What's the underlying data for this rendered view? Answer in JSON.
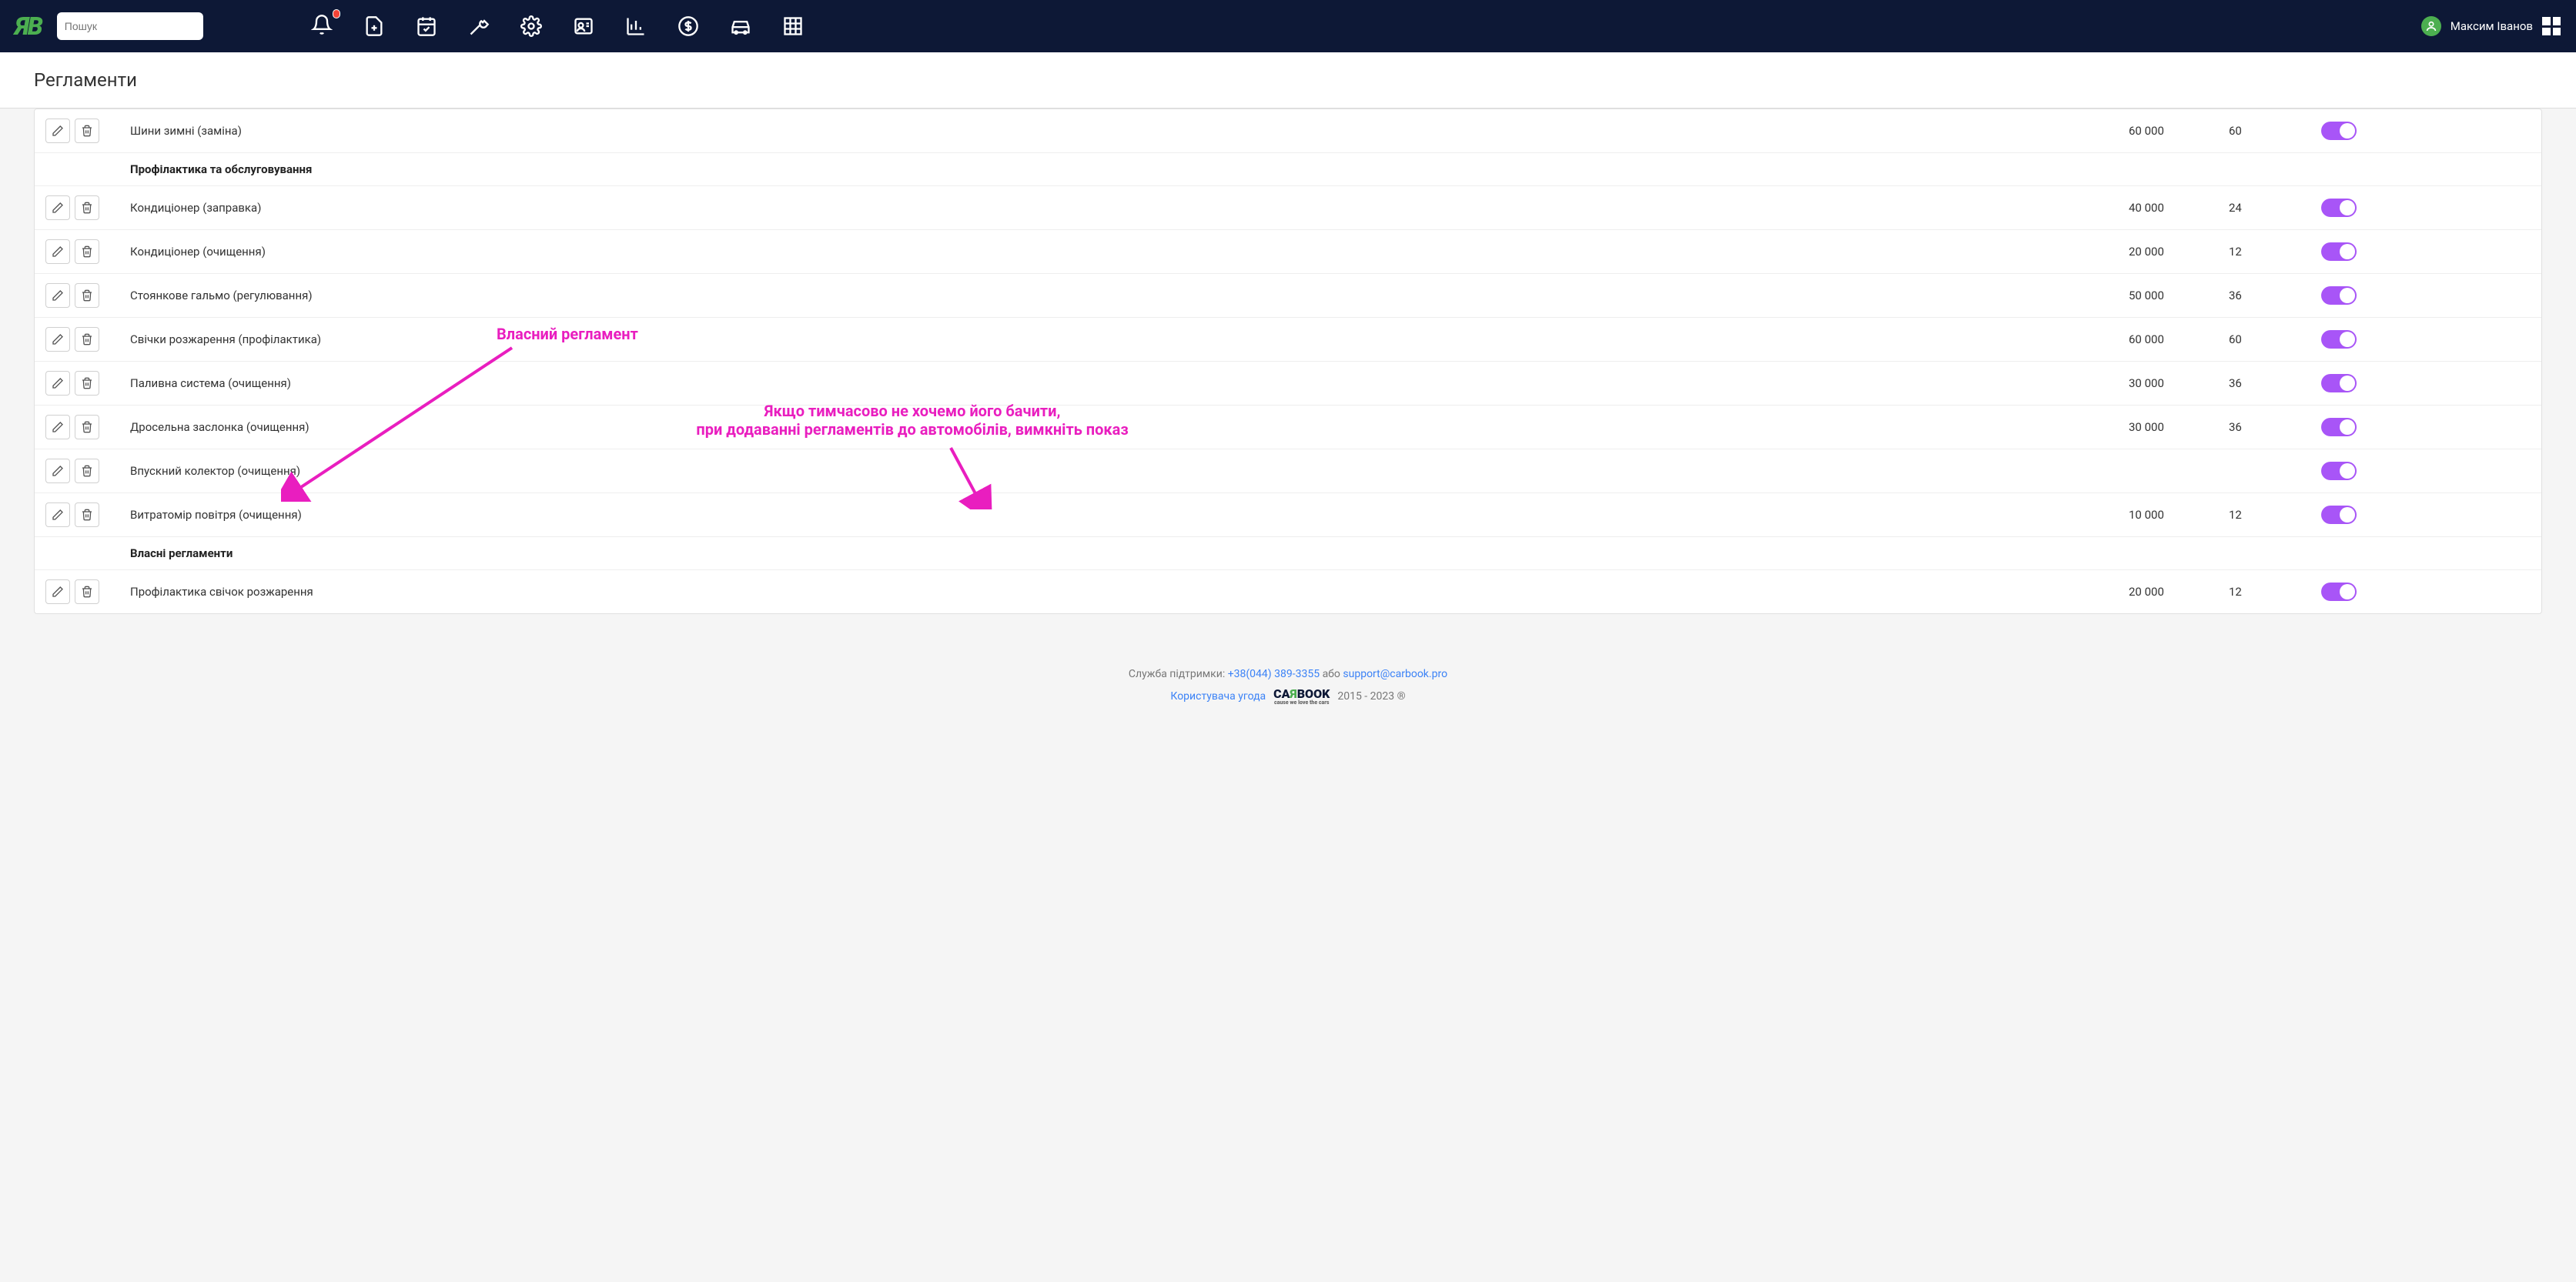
{
  "header": {
    "search_placeholder": "Пошук",
    "user_name": "Максим Іванов"
  },
  "page": {
    "title": "Регламенти"
  },
  "table": {
    "rows": [
      {
        "type": "data",
        "name": "Шини зимні (заміна)",
        "km": "60 000",
        "months": "60",
        "on": true
      },
      {
        "type": "group",
        "name": "Профілактика та обслуговування"
      },
      {
        "type": "data",
        "name": "Кондиціонер (заправка)",
        "km": "40 000",
        "months": "24",
        "on": true
      },
      {
        "type": "data",
        "name": "Кондиціонер (очищення)",
        "km": "20 000",
        "months": "12",
        "on": true
      },
      {
        "type": "data",
        "name": "Стоянкове гальмо (регулювання)",
        "km": "50 000",
        "months": "36",
        "on": true
      },
      {
        "type": "data",
        "name": "Свічки розжарення (профілактика)",
        "km": "60 000",
        "months": "60",
        "on": true
      },
      {
        "type": "data",
        "name": "Паливна система (очищення)",
        "km": "30 000",
        "months": "36",
        "on": true
      },
      {
        "type": "data",
        "name": "Дросельна заслонка (очищення)",
        "km": "30 000",
        "months": "36",
        "on": true
      },
      {
        "type": "data",
        "name": "Впускний колектор (очищення)",
        "km": "",
        "months": "",
        "on": true
      },
      {
        "type": "data",
        "name": "Витратомір повітря (очищення)",
        "km": "10 000",
        "months": "12",
        "on": true
      },
      {
        "type": "group",
        "name": "Власні регламенти"
      },
      {
        "type": "data",
        "name": "Профілактика свічок розжарення",
        "km": "20 000",
        "months": "12",
        "on": true
      }
    ]
  },
  "annotations": {
    "a1": "Власний регламент",
    "a2_line1": "Якщо тимчасово не хочемо його бачити,",
    "a2_line2": "при додаванні регламентів до автомобілів, вимкніть показ"
  },
  "footer": {
    "support_label": "Служба підтримки:",
    "phone": "+38(044) 389-3355",
    "or": "або",
    "email": "support@carbook.pro",
    "agreement": "Користувача угода",
    "years": "2015 - 2023 ®"
  }
}
